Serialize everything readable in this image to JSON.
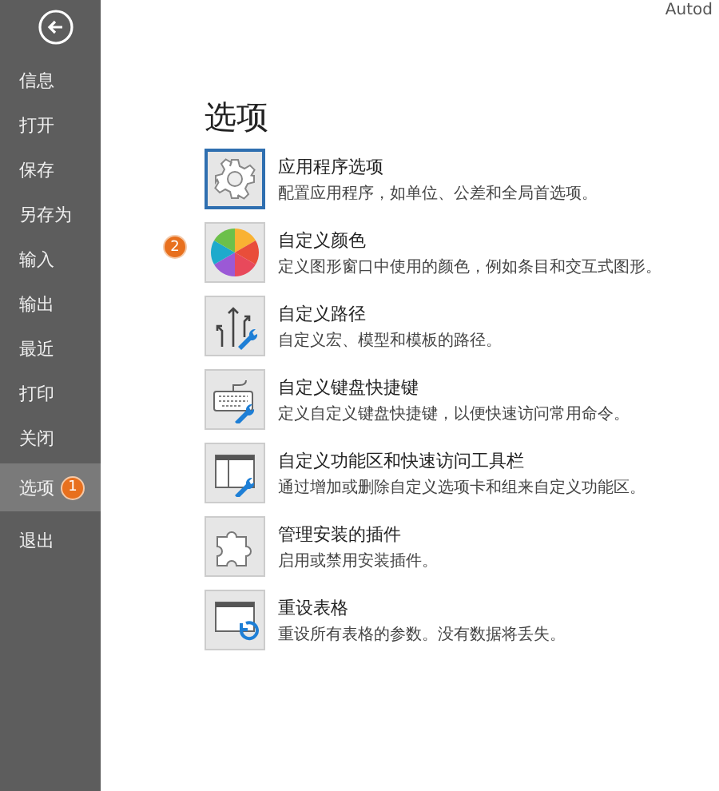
{
  "header": {
    "corner_text": "Autod"
  },
  "sidebar": {
    "items": [
      {
        "label": "信息",
        "selected": false
      },
      {
        "label": "打开",
        "selected": false
      },
      {
        "label": "保存",
        "selected": false
      },
      {
        "label": "另存为",
        "selected": false
      },
      {
        "label": "输入",
        "selected": false
      },
      {
        "label": "输出",
        "selected": false
      },
      {
        "label": "最近",
        "selected": false
      },
      {
        "label": "打印",
        "selected": false
      },
      {
        "label": "关闭",
        "selected": false
      },
      {
        "label": "选项",
        "selected": true,
        "badge": "1"
      },
      {
        "label": "退出",
        "selected": false
      }
    ]
  },
  "page": {
    "title": "选项",
    "options": [
      {
        "kind": "gear",
        "title": "应用程序选项",
        "description": "配置应用程序，如单位、公差和全局首选项。",
        "selected": true
      },
      {
        "kind": "colors",
        "title": "自定义颜色",
        "description": "定义图形窗口中使用的颜色，例如条目和交互式图形。",
        "selected": false,
        "badge": "2"
      },
      {
        "kind": "paths",
        "title": "自定义路径",
        "description": "自定义宏、模型和模板的路径。",
        "selected": false
      },
      {
        "kind": "keyboard",
        "title": "自定义键盘快捷键",
        "description": "定义自定义键盘快捷键，以便快速访问常用命令。",
        "selected": false
      },
      {
        "kind": "ribbon",
        "title": "自定义功能区和快速访问工具栏",
        "description": "通过增加或删除自定义选项卡和组来自定义功能区。",
        "selected": false
      },
      {
        "kind": "plugin",
        "title": "管理安装的插件",
        "description": "启用或禁用安装插件。",
        "selected": false
      },
      {
        "kind": "reset",
        "title": "重设表格",
        "description": "重设所有表格的参数。没有数据将丢失。",
        "selected": false
      }
    ]
  }
}
